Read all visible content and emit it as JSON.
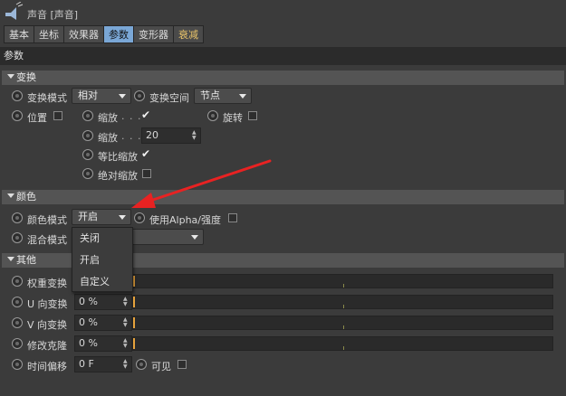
{
  "title": "声音 [声音]",
  "tabs": [
    "基本",
    "坐标",
    "效果器",
    "参数",
    "变形器",
    "衰减"
  ],
  "param_header": "参数",
  "sections": {
    "transform": "变换",
    "color": "颜色",
    "other": "其他"
  },
  "transform": {
    "mode_label": "变换模式",
    "mode_value": "相对",
    "space_label": "变换空间",
    "space_value": "节点",
    "position_label": "位置",
    "scale_label": "缩放",
    "rotate_label": "旋转",
    "scale2_label": "缩放",
    "scale2_value": "20",
    "uniform_label": "等比缩放",
    "absolute_label": "绝对缩放",
    "dots": ". . ."
  },
  "color": {
    "mode_label": "颜色模式",
    "mode_value": "开启",
    "alpha_label": "使用Alpha/强度",
    "blend_label": "混合模式"
  },
  "color_menu": [
    "关闭",
    "开启",
    "自定义"
  ],
  "other": {
    "weight_label": "权重变换",
    "u_label": "U 向变换",
    "u_value": "0 %",
    "v_label": "V 向变换",
    "v_value": "0 %",
    "clone_label": "修改克隆",
    "clone_value": "0 %",
    "offset_label": "时间偏移",
    "offset_value": "0 F",
    "visible_label": "可见"
  },
  "colors": {
    "accent_tab": "#7aa7d6",
    "marker": "#e6a23c",
    "annotation_arrow": "#e82222"
  },
  "icons": [
    "speaker-icon",
    "check-icon",
    "dropdown-arrow-icon",
    "spinner-icon"
  ]
}
